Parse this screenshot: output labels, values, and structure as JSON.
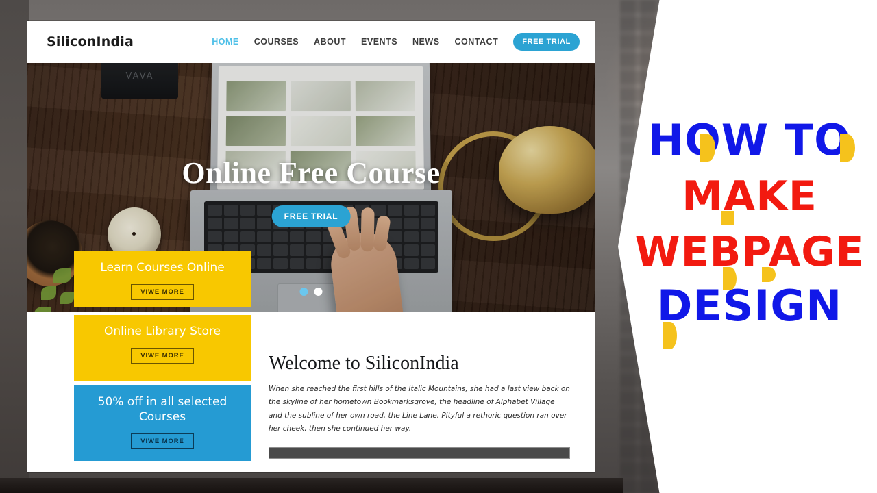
{
  "thumbnail_overlay": {
    "line1": "HOW TO",
    "line2": "MAKE",
    "line3": "WEBPAGE",
    "line4": "DESIGN",
    "colors": {
      "blue": "#1118E8",
      "red": "#F21A10",
      "yellow": "#F5C21C"
    }
  },
  "website": {
    "navbar": {
      "logo": "SiliconIndia",
      "links": [
        {
          "label": "HOME",
          "active": true
        },
        {
          "label": "COURSES",
          "active": false
        },
        {
          "label": "ABOUT",
          "active": false
        },
        {
          "label": "EVENTS",
          "active": false
        },
        {
          "label": "NEWS",
          "active": false
        },
        {
          "label": "CONTACT",
          "active": false
        }
      ],
      "cta_label": "FREE TRIAL",
      "accent_color": "#2BA3D3",
      "active_link_color": "#4FC0E8"
    },
    "hero": {
      "title": "Online Free Course",
      "cta_label": "FREE TRIAL",
      "speaker_logo": "VAVA",
      "carousel": {
        "total_dots": 2,
        "active_index": 0
      }
    },
    "cards": [
      {
        "title": "Learn Courses Online",
        "button_label": "VIWE MORE",
        "color": "#F8C800",
        "style": "yellow"
      },
      {
        "title": "Online Library Store",
        "button_label": "VIWE MORE",
        "color": "#F8C800",
        "style": "yellow"
      },
      {
        "title": "50% off in all selected Courses",
        "button_label": "VIWE MORE",
        "color": "#259BD3",
        "style": "blue"
      }
    ],
    "welcome": {
      "title": "Welcome to SiliconIndia",
      "body": "When she reached the first hills of the Italic Mountains, she had a last view back on the skyline of her hometown Bookmarksgrove, the headline of Alphabet Village and the subline of her own road, the Line Lane, Pityful a rethoric question ran over her cheek, then she continued her way.",
      "bar_color": "#4a4a4a"
    }
  }
}
